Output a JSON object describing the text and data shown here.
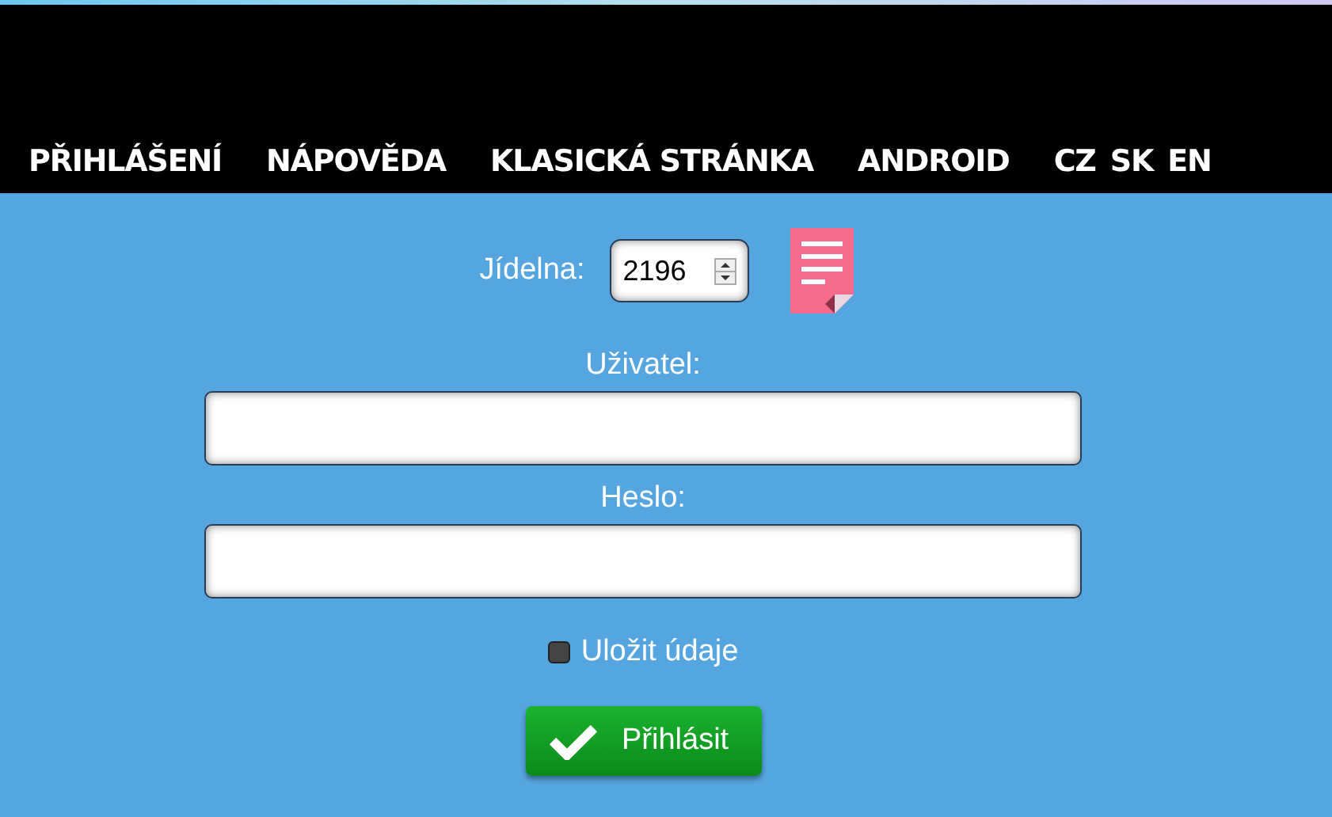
{
  "nav": {
    "items": [
      "PŘIHLÁŠENÍ",
      "NÁPOVĚDA",
      "KLASICKÁ STRÁNKA",
      "ANDROID"
    ],
    "languages": [
      "CZ",
      "SK",
      "EN"
    ]
  },
  "form": {
    "canteen_label": "Jídelna:",
    "canteen_value": "2196",
    "user_label": "Uživatel:",
    "password_label": "Heslo:",
    "remember": {
      "label": "Uložit údaje",
      "checked": false
    },
    "submit": "Přihlásit"
  }
}
